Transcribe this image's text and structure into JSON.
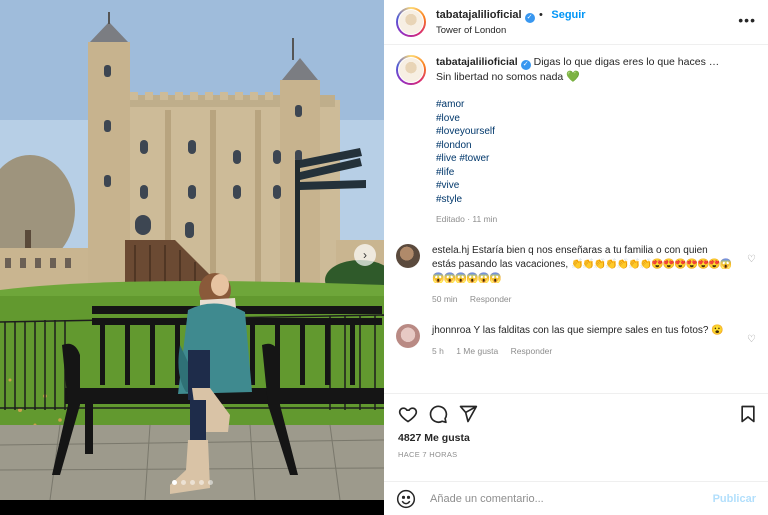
{
  "post": {
    "username": "tabatajalilioficial",
    "follow_label": "Seguir",
    "location": "Tower of London",
    "more_icon": "more-options-icon"
  },
  "caption": {
    "username": "tabatajalilioficial",
    "text": "Digas lo que digas eres lo que haces …",
    "line2": "Sin libertad no somos nada",
    "heart": "💚",
    "tags": [
      "#amor",
      "#love",
      "#loveyourself",
      "#london",
      "#live #tower",
      "#life",
      "#vive",
      "#style"
    ],
    "meta": "Editado · 11 min"
  },
  "comments": [
    {
      "username": "estela.hj",
      "text": "Estaría bien q nos enseñaras a tu familia o con quien estás pasando las vacaciones,",
      "emojis": "👏👏👏👏👏👏👏😍😍😍😍😍😍😱😱😱😱😱😱😱",
      "time": "50 min",
      "reply": "Responder",
      "likes": ""
    },
    {
      "username": "jhonnroa",
      "text": "Y las falditas con las que siempre sales en tus fotos?",
      "emojis": "😮",
      "time": "5 h",
      "likes": "1 Me gusta",
      "reply": "Responder"
    }
  ],
  "actions": {
    "likes": "4827 Me gusta",
    "time": "HACE 7 HORAS"
  },
  "add_comment": {
    "placeholder": "Añade un comentario...",
    "publish": "Publicar"
  },
  "colors": {
    "accent": "#0095f6",
    "hashtag": "#00376b",
    "muted": "#8e8e8e"
  }
}
